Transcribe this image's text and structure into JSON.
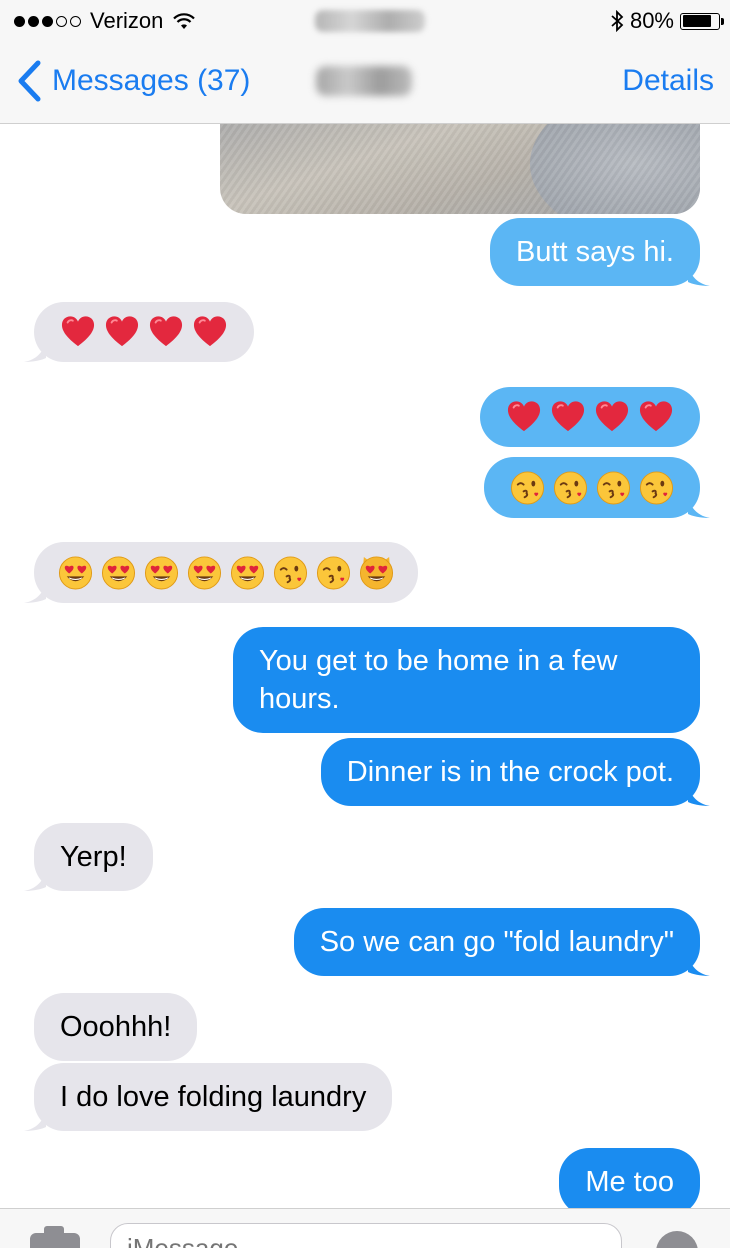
{
  "status_bar": {
    "carrier": "Verizon",
    "signal_bars_filled": 3,
    "signal_bars_total": 5,
    "battery_percent": "80%",
    "battery_level": 0.8
  },
  "nav": {
    "back_label": "Messages (37)",
    "details_label": "Details"
  },
  "messages": [
    {
      "side": "sent",
      "text": "Butt says hi."
    },
    {
      "side": "received",
      "emoji": [
        "red-heart",
        "red-heart",
        "red-heart",
        "red-heart"
      ]
    },
    {
      "side": "sent",
      "emoji": [
        "red-heart",
        "red-heart",
        "red-heart",
        "red-heart"
      ]
    },
    {
      "side": "sent",
      "emoji": [
        "face-blowing-kiss",
        "face-blowing-kiss",
        "face-blowing-kiss",
        "face-blowing-kiss"
      ]
    },
    {
      "side": "received",
      "emoji": [
        "smiling-face-heart-eyes",
        "smiling-face-heart-eyes",
        "smiling-face-heart-eyes",
        "smiling-face-heart-eyes",
        "smiling-face-heart-eyes",
        "face-blowing-kiss",
        "face-blowing-kiss",
        "cat-heart-eyes"
      ]
    },
    {
      "side": "sent",
      "text": "You get to be home in a few hours."
    },
    {
      "side": "sent",
      "text": "Dinner is in the crock pot."
    },
    {
      "side": "received",
      "text": "Yerp!"
    },
    {
      "side": "sent",
      "text": "So we can go \"fold laundry\""
    },
    {
      "side": "received",
      "text": "Ooohhh!"
    },
    {
      "side": "received",
      "text": "I do love folding laundry"
    },
    {
      "side": "sent",
      "text": "Me too"
    }
  ],
  "input": {
    "placeholder": "iMessage"
  },
  "colors": {
    "accent": "#1a7cf0",
    "sent_bubble": "#1a8cf0",
    "received_bubble": "#e6e5eb"
  }
}
